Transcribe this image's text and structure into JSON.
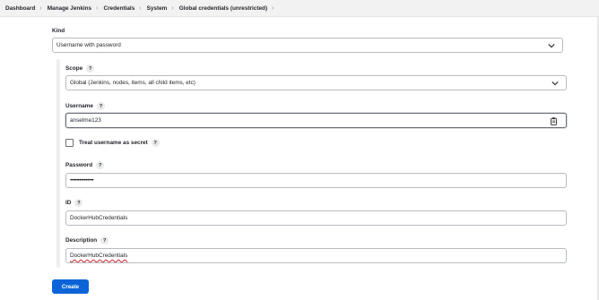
{
  "breadcrumb": {
    "items": [
      "Dashboard",
      "Manage Jenkins",
      "Credentials",
      "System",
      "Global credentials (unrestricted)"
    ]
  },
  "form": {
    "kind": {
      "label": "Kind",
      "value": "Username with password"
    },
    "scope": {
      "label": "Scope",
      "help": "?",
      "value": "Global (Jenkins, nodes, items, all child items, etc)"
    },
    "username": {
      "label": "Username",
      "help": "?",
      "value": "anselme123"
    },
    "treat_secret": {
      "label": "Treat username as secret",
      "help": "?",
      "checked": false
    },
    "password": {
      "label": "Password",
      "help": "?",
      "value": "•••••••••••••••"
    },
    "id": {
      "label": "ID",
      "help": "?",
      "value": "DockerHubCredentials"
    },
    "description": {
      "label": "Description",
      "help": "?",
      "value": "DockerHubCredentials"
    },
    "create_label": "Create"
  },
  "colors": {
    "primary": "#0a64d8",
    "breadcrumb_bg": "#f2f2f3",
    "border": "#b7bbc0"
  },
  "icons": {
    "separator": "chevron-right-icon",
    "dropdown": "chevron-down-icon",
    "clipboard": "clipboard-icon"
  }
}
